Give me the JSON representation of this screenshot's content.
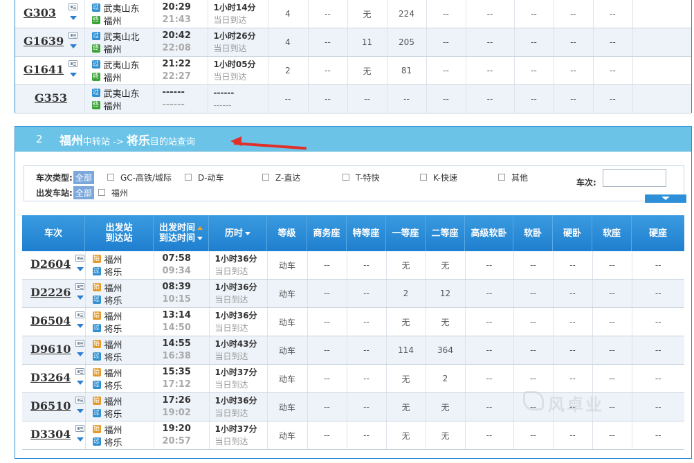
{
  "top_rows": [
    {
      "no": "G303",
      "detail": true,
      "from": "武夷山东",
      "to": "福州",
      "from_type": "过",
      "to_type": "终",
      "dep": "20:29",
      "arr": "21:43",
      "dur": "1小时14分",
      "arrive_day": "当日到达",
      "cols": [
        "4",
        "--",
        "无",
        "224",
        "--",
        "--",
        "--",
        "--",
        "--"
      ]
    },
    {
      "no": "G1639",
      "detail": true,
      "from": "武夷山北",
      "to": "福州",
      "from_type": "过",
      "to_type": "终",
      "dep": "20:42",
      "arr": "22:08",
      "dur": "1小时26分",
      "arrive_day": "当日到达",
      "cols": [
        "4",
        "--",
        "11",
        "205",
        "--",
        "--",
        "--",
        "--",
        "--"
      ]
    },
    {
      "no": "G1641",
      "detail": true,
      "from": "武夷山东",
      "to": "福州",
      "from_type": "过",
      "to_type": "终",
      "dep": "21:22",
      "arr": "22:27",
      "dur": "1小时05分",
      "arrive_day": "当日到达",
      "cols": [
        "2",
        "--",
        "无",
        "81",
        "--",
        "--",
        "--",
        "--",
        "--"
      ]
    },
    {
      "no": "G353",
      "detail": false,
      "from": "武夷山东",
      "to": "福州",
      "from_type": "过",
      "to_type": "终",
      "dep": "------",
      "arr": "------",
      "dur": "------",
      "arrive_day": "------",
      "cols": [
        "--",
        "--",
        "--",
        "--",
        "--",
        "--",
        "--",
        "--",
        "--"
      ]
    }
  ],
  "section2": {
    "num": "2",
    "from_city": "福州",
    "mid_label": "中转站 -> ",
    "to_city": "将乐",
    "suffix": "目的站查询"
  },
  "filter": {
    "type_label": "车次类型:",
    "all_label": "全部",
    "types": [
      "GC-高铁/城际",
      "D-动车",
      "Z-直达",
      "T-特快",
      "K-快速",
      "其他"
    ],
    "train_no_label": "车次:",
    "station_label": "出发车站:",
    "stations": [
      "福州"
    ]
  },
  "headers": {
    "train": "车次",
    "station_1": "出发站",
    "station_2": "到达站",
    "time_1": "出发时间",
    "time_2": "到达时间",
    "duration": "历时",
    "grade": "等级",
    "seat_types": [
      "商务座",
      "特等座",
      "一等座",
      "二等座",
      "高级软卧",
      "软卧",
      "硬卧",
      "软座",
      "硬座"
    ]
  },
  "rows": [
    {
      "no": "D2604",
      "from": "福州",
      "to": "将乐",
      "from_type": "始",
      "to_type": "过",
      "dep": "07:58",
      "arr": "09:34",
      "dur": "1小时36分",
      "arrive_day": "当日到达",
      "grade": "动车",
      "cols": [
        "--",
        "--",
        "无",
        "无",
        "--",
        "--",
        "--",
        "--",
        "--"
      ]
    },
    {
      "no": "D2226",
      "from": "福州",
      "to": "将乐",
      "from_type": "始",
      "to_type": "过",
      "dep": "08:39",
      "arr": "10:15",
      "dur": "1小时36分",
      "arrive_day": "当日到达",
      "grade": "动车",
      "cols": [
        "--",
        "--",
        "2",
        "12",
        "--",
        "--",
        "--",
        "--",
        "--"
      ]
    },
    {
      "no": "D6504",
      "from": "福州",
      "to": "将乐",
      "from_type": "始",
      "to_type": "过",
      "dep": "13:14",
      "arr": "14:50",
      "dur": "1小时36分",
      "arrive_day": "当日到达",
      "grade": "动车",
      "cols": [
        "--",
        "--",
        "无",
        "无",
        "--",
        "--",
        "--",
        "--",
        "--"
      ]
    },
    {
      "no": "D9610",
      "from": "福州",
      "to": "将乐",
      "from_type": "始",
      "to_type": "过",
      "dep": "14:55",
      "arr": "16:38",
      "dur": "1小时43分",
      "arrive_day": "当日到达",
      "grade": "动车",
      "cols": [
        "--",
        "--",
        "114",
        "364",
        "--",
        "--",
        "--",
        "--",
        "--"
      ]
    },
    {
      "no": "D3264",
      "from": "福州",
      "to": "将乐",
      "from_type": "始",
      "to_type": "过",
      "dep": "15:35",
      "arr": "17:12",
      "dur": "1小时37分",
      "arrive_day": "当日到达",
      "grade": "动车",
      "cols": [
        "--",
        "--",
        "无",
        "2",
        "--",
        "--",
        "--",
        "--",
        "--"
      ]
    },
    {
      "no": "D6510",
      "from": "福州",
      "to": "将乐",
      "from_type": "始",
      "to_type": "过",
      "dep": "17:26",
      "arr": "19:02",
      "dur": "1小时36分",
      "arrive_day": "当日到达",
      "grade": "动车",
      "cols": [
        "--",
        "--",
        "无",
        "无",
        "--",
        "--",
        "--",
        "--",
        "--"
      ]
    },
    {
      "no": "D3304",
      "from": "福州",
      "to": "将乐",
      "from_type": "始",
      "to_type": "过",
      "dep": "19:20",
      "arr": "20:57",
      "dur": "1小时37分",
      "arrive_day": "当日到达",
      "grade": "动车",
      "cols": [
        "--",
        "--",
        "无",
        "无",
        "--",
        "--",
        "--",
        "--",
        "--"
      ]
    }
  ],
  "watermark": "风卓业",
  "colors": {
    "accent": "#2c8fd8",
    "section_header": "#6bc4e8",
    "table_header": "#1f7fcf",
    "annotation_arrow": "#e0302a",
    "badge_start": "#e39a2b",
    "badge_pass": "#2f8fd0",
    "badge_end": "#3aa335"
  }
}
